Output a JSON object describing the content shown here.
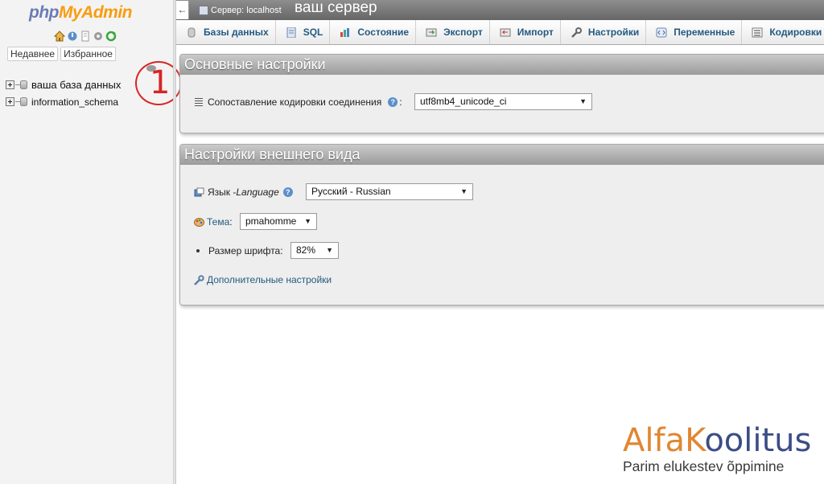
{
  "nav": {
    "logo_php": "php",
    "logo_myadmin": "MyAdmin",
    "recent_label": "Недавнее",
    "favorites_label": "Избранное",
    "databases": [
      {
        "name": "ваша база данных"
      },
      {
        "name": "information_schema"
      }
    ],
    "annotation_number": "1"
  },
  "topbar": {
    "collapse_symbol": "←",
    "server_label": "Сервер: localhost",
    "server_note": "ваш сервер"
  },
  "tabs": [
    {
      "label": "Базы данных",
      "icon": "databases-icon"
    },
    {
      "label": "SQL",
      "icon": "sql-icon"
    },
    {
      "label": "Состояние",
      "icon": "status-icon"
    },
    {
      "label": "Экспорт",
      "icon": "export-icon"
    },
    {
      "label": "Импорт",
      "icon": "import-icon"
    },
    {
      "label": "Настройки",
      "icon": "settings-wrench-icon"
    },
    {
      "label": "Переменные",
      "icon": "variables-icon"
    },
    {
      "label": "Кодировки",
      "icon": "charsets-icon"
    }
  ],
  "general_settings": {
    "title": "Основные настройки",
    "collation_label": "Сопоставление кодировки соединения",
    "collation_colon": ":",
    "collation_value": "utf8mb4_unicode_ci"
  },
  "appearance_settings": {
    "title": "Настройки внешнего вида",
    "language_label": "Язык - ",
    "language_label_italic": "Language",
    "language_value": "Русский - Russian",
    "theme_label": "Тема",
    "theme_colon": ":",
    "theme_value": "pmahomme",
    "font_size_label": "Размер шрифта:",
    "font_size_value": "82%",
    "more_settings_link": "Дополнительные настройки"
  },
  "watermark": {
    "title_part1": "Alfa",
    "title_part2": "K",
    "title_part3": "oolitus",
    "subtitle": "Parim elukestev õppimine"
  },
  "colors": {
    "link": "#235a81",
    "logo_php": "#6c7bb6",
    "logo_myadmin": "#f89c0e",
    "annotation": "#d92424"
  }
}
